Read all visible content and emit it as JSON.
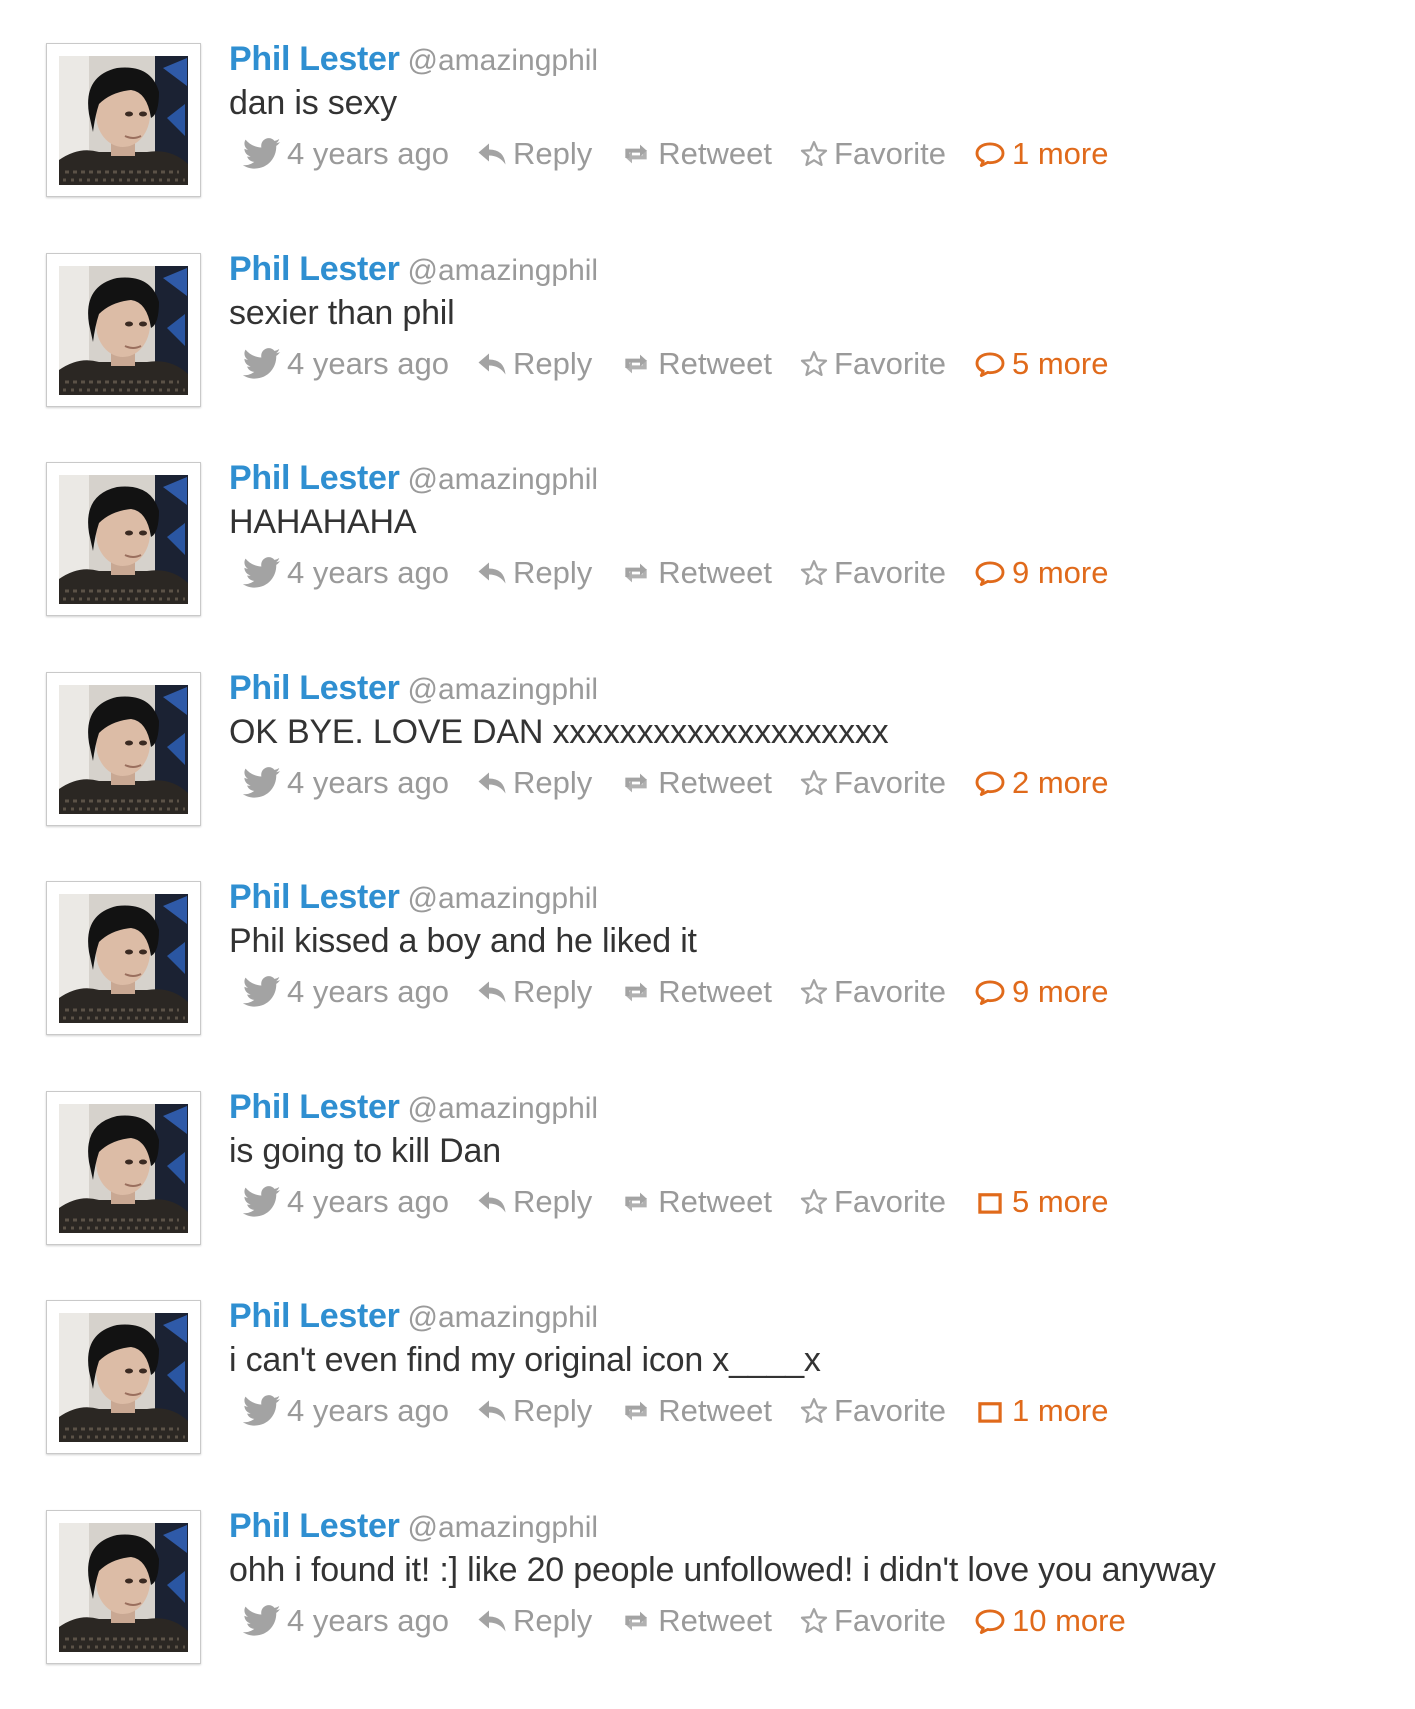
{
  "colors": {
    "name": "#2f8fd1",
    "meta": "#9a9a9a",
    "text": "#333333",
    "more": "#e06a1b"
  },
  "tweets": [
    {
      "name": "Phil Lester",
      "handle": "@amazingphil",
      "text": "dan is sexy",
      "time": "4 years ago",
      "reply": "Reply",
      "retweet": "Retweet",
      "favorite": "Favorite",
      "more": "1 more",
      "more_icon": "speech-bubble-icon"
    },
    {
      "name": "Phil Lester",
      "handle": "@amazingphil",
      "text": "sexier than phil",
      "time": "4 years ago",
      "reply": "Reply",
      "retweet": "Retweet",
      "favorite": "Favorite",
      "more": "5 more",
      "more_icon": "speech-bubble-icon"
    },
    {
      "name": "Phil Lester",
      "handle": "@amazingphil",
      "text": "HAHAHAHA",
      "time": "4 years ago",
      "reply": "Reply",
      "retweet": "Retweet",
      "favorite": "Favorite",
      "more": "9 more",
      "more_icon": "speech-bubble-icon"
    },
    {
      "name": "Phil Lester",
      "handle": "@amazingphil",
      "text": "OK BYE. LOVE DAN xxxxxxxxxxxxxxxxxxxx",
      "time": "4 years ago",
      "reply": "Reply",
      "retweet": "Retweet",
      "favorite": "Favorite",
      "more": "2 more",
      "more_icon": "speech-bubble-icon"
    },
    {
      "name": "Phil Lester",
      "handle": "@amazingphil",
      "text": "Phil kissed a boy and he liked it",
      "time": "4 years ago",
      "reply": "Reply",
      "retweet": "Retweet",
      "favorite": "Favorite",
      "more": "9 more",
      "more_icon": "speech-bubble-icon"
    },
    {
      "name": "Phil Lester",
      "handle": "@amazingphil",
      "text": "is going to kill Dan",
      "time": "4 years ago",
      "reply": "Reply",
      "retweet": "Retweet",
      "favorite": "Favorite",
      "more": "5 more",
      "more_icon": "square-icon"
    },
    {
      "name": "Phil Lester",
      "handle": "@amazingphil",
      "text": "i can't even find my original icon x____x",
      "time": "4 years ago",
      "reply": "Reply",
      "retweet": "Retweet",
      "favorite": "Favorite",
      "more": "1 more",
      "more_icon": "square-icon"
    },
    {
      "name": "Phil Lester",
      "handle": "@amazingphil",
      "text": "ohh i found it! :] like 20 people unfollowed! i didn't love you anyway",
      "time": "4 years ago",
      "reply": "Reply",
      "retweet": "Retweet",
      "favorite": "Favorite",
      "more": "10 more",
      "more_icon": "speech-bubble-icon"
    }
  ]
}
